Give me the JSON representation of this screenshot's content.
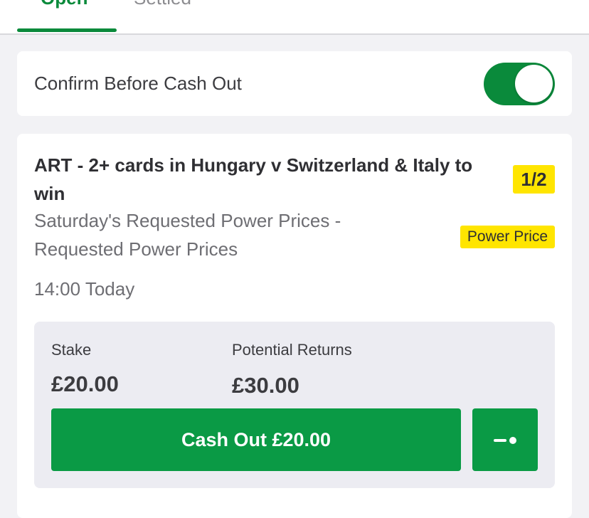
{
  "tabs": {
    "open_label": "Open",
    "settled_label": "Settled"
  },
  "confirm": {
    "label": "Confirm Before Cash Out",
    "toggle_on": true
  },
  "bet": {
    "title": "ART - 2+ cards in Hungary v Switzerland & Italy to win",
    "odds": "1/2",
    "subtitle": "Saturday's Requested Power Prices - Requested Power Prices",
    "power_badge": "Power Price",
    "time": "14:00 Today",
    "stake_label": "Stake",
    "stake_value": "£20.00",
    "returns_label": "Potential Returns",
    "returns_value": "£30.00",
    "cashout_label": "Cash Out £20.00",
    "slider_icon": "partial-cashout-slider-icon"
  },
  "colors": {
    "brand_green": "#0a9a45",
    "badge_yellow": "#ffe500",
    "background": "#f2f2f5"
  }
}
